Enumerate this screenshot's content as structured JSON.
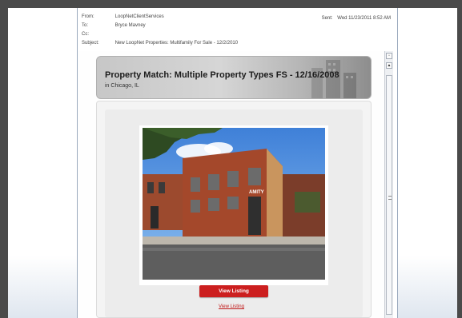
{
  "email": {
    "from_label": "From:",
    "from_value": "LoopNetClientServices",
    "to_label": "To:",
    "to_value": "Bryce Mavney",
    "cc_label": "Cc:",
    "subject_label": "Subject:",
    "subject_value": "New LoopNet Properties: Multifamily For Sale - 12/2/2010",
    "sent_label": "Sent:",
    "sent_value": "Wed 11/23/2011 8:52 AM"
  },
  "listing": {
    "title": "Property Match: Multiple Property Types FS - 12/16/2008",
    "location": "in Chicago, IL",
    "photo_sign": "AMITY",
    "button_label": "View Listing",
    "link_label": "View Listing"
  },
  "scrollbar": {
    "up_icon": "▲",
    "top_icon": "▫"
  },
  "colors": {
    "frame": "#4a4a4a",
    "button_red": "#cc1f1f",
    "link_red": "#c01818"
  }
}
